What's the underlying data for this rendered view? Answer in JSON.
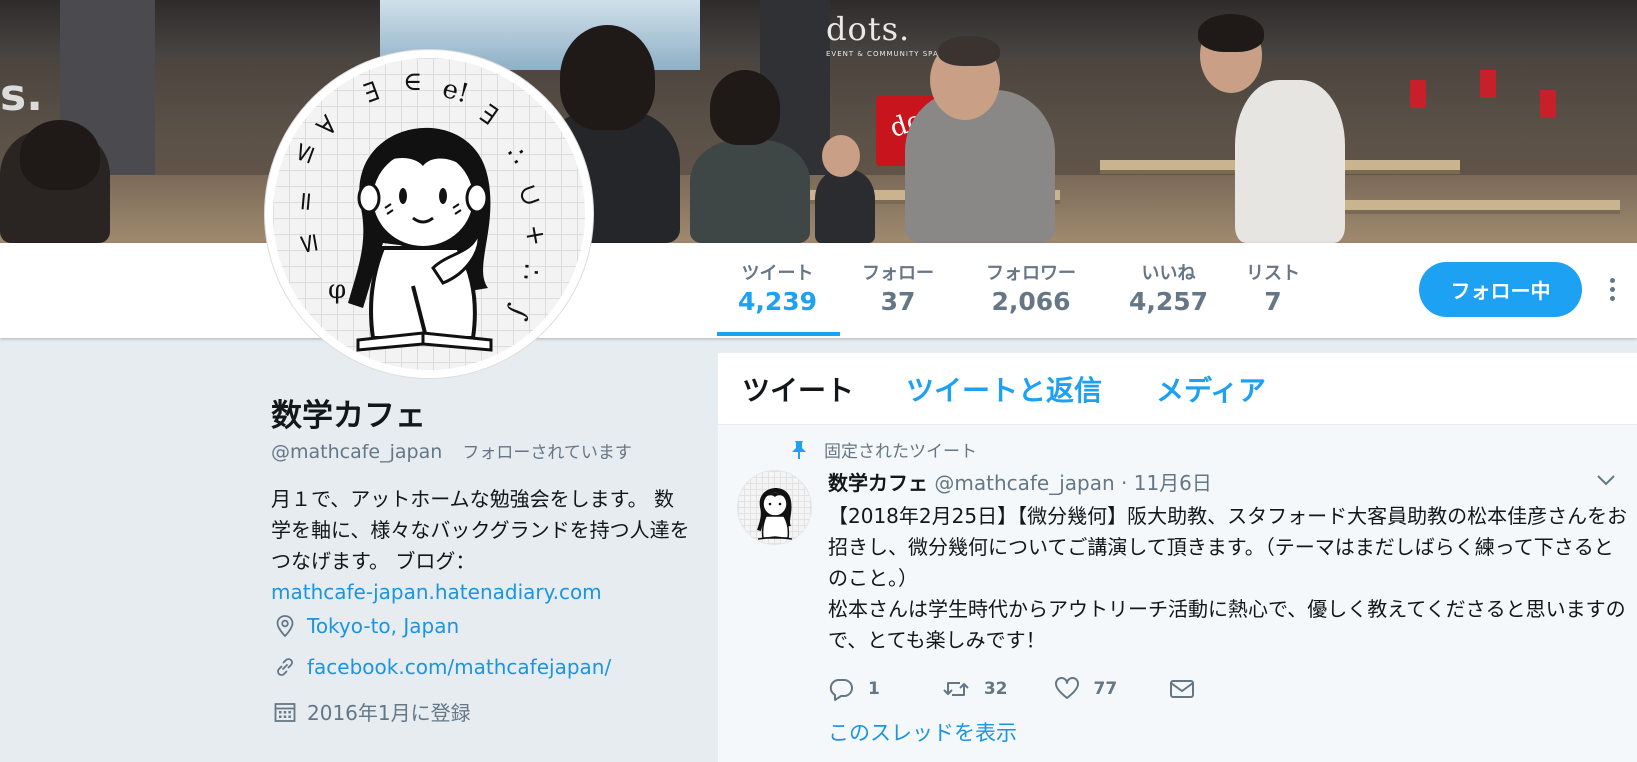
{
  "banner": {
    "sign_text": "dots.",
    "sign_sub": "EVENT & COMMUNITY SPACE",
    "box_text": "dot",
    "wall_text": "s."
  },
  "stats": [
    {
      "label": "ツイート",
      "value": "4,239"
    },
    {
      "label": "フォロー",
      "value": "37"
    },
    {
      "label": "フォロワー",
      "value": "2,066"
    },
    {
      "label": "いいね",
      "value": "4,257"
    },
    {
      "label": "リスト",
      "value": "7"
    }
  ],
  "follow_button": "フォロー中",
  "profile": {
    "name": "数学カフェ",
    "handle": "@mathcafe_japan",
    "follows_you": "フォローされています",
    "bio_text": "月１で、アットホームな勉強会をします。 数学を軸に、様々なバックグランドを持つ人達をつなげます。 ブログ：",
    "bio_link": "mathcafe-japan.hatenadiary.com",
    "location": "Tokyo-to, Japan",
    "website": "facebook.com/mathcafejapan/",
    "joined": "2016年1月に登録"
  },
  "tabs": [
    {
      "label": "ツイート"
    },
    {
      "label": "ツイートと返信"
    },
    {
      "label": "メディア"
    }
  ],
  "tweet": {
    "pinned_label": "固定されたツイート",
    "name": "数学カフェ",
    "handle": "@mathcafe_japan",
    "dot": "·",
    "date": "11月6日",
    "text": "【2018年2月25日】【微分幾何】阪大助教、スタフォード大客員助教の松本佳彦さんをお招きし、微分幾何についてご講演して頂きます。（テーマはまだしばらく練って下さるとのこと。）\n松本さんは学生時代からアウトリーチ活動に熱心で、優しく教えてくださると思いますので、とても楽しみです！",
    "replies": "1",
    "retweets": "32",
    "likes": "77",
    "thread_link": "このスレッドを表示"
  },
  "colors": {
    "accent": "#1da1f2",
    "link": "#1b95e0",
    "muted": "#657786",
    "background": "#e6ecf0"
  },
  "icons": [
    "pin-icon",
    "reply-icon",
    "retweet-icon",
    "like-icon",
    "direct-message-icon",
    "location-icon",
    "link-icon",
    "calendar-icon",
    "chevron-down-icon",
    "more-vertical-icon"
  ]
}
